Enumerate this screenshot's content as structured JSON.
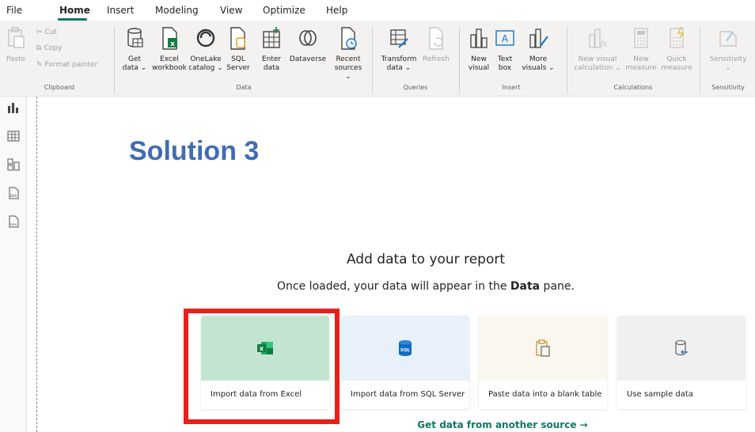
{
  "menu": {
    "items": [
      "File",
      "Home",
      "Insert",
      "Modeling",
      "View",
      "Optimize",
      "Help"
    ]
  },
  "ribbon": {
    "clipboard": {
      "paste": "Paste",
      "cut": "Cut",
      "copy": "Copy",
      "format_painter": "Format painter",
      "label": "Clipboard"
    },
    "data": {
      "get_data": [
        "Get",
        "data ⌄"
      ],
      "excel": [
        "Excel",
        "workbook"
      ],
      "onelake": [
        "OneLake",
        "catalog ⌄"
      ],
      "sql": [
        "SQL",
        "Server"
      ],
      "enter": [
        "Enter",
        "data"
      ],
      "dataverse": [
        "Dataverse",
        ""
      ],
      "recent": [
        "Recent",
        "sources ⌄"
      ],
      "label": "Data"
    },
    "queries": {
      "transform": [
        "Transform",
        "data ⌄"
      ],
      "refresh": [
        "Refresh",
        ""
      ],
      "label": "Queries"
    },
    "insert": {
      "new_visual": [
        "New",
        "visual"
      ],
      "text_box": [
        "Text",
        "box"
      ],
      "more_visuals": [
        "More",
        "visuals ⌄"
      ],
      "label": "Insert"
    },
    "calculations": {
      "new_visual_calc": [
        "New visual",
        "calculation ⌄"
      ],
      "new_measure": [
        "New",
        "measure"
      ],
      "quick_measure": [
        "Quick",
        "measure"
      ],
      "label": "Calculations"
    },
    "sensitivity": {
      "button": [
        "Sensitivity",
        "⌄"
      ],
      "label": "Sensitivity"
    }
  },
  "canvas": {
    "solution_label": "Solution 3",
    "title": "Add data to your report",
    "subtitle_before": "Once loaded, your data will appear in the ",
    "subtitle_bold": "Data",
    "subtitle_after": " pane.",
    "cards": [
      {
        "label": "Import data from Excel",
        "bg": "#c4e4d2"
      },
      {
        "label": "Import data from SQL Server",
        "bg": "#e8f0f9"
      },
      {
        "label": "Paste data into a blank table",
        "bg": "#faf7ef"
      },
      {
        "label": "Use sample data",
        "bg": "#f0f0f0"
      }
    ],
    "get_data_link": "Get data from another source →"
  },
  "colors": {
    "accent": "#117865",
    "solution_blue": "#3f6db3",
    "highlight_red": "#e8201a"
  }
}
